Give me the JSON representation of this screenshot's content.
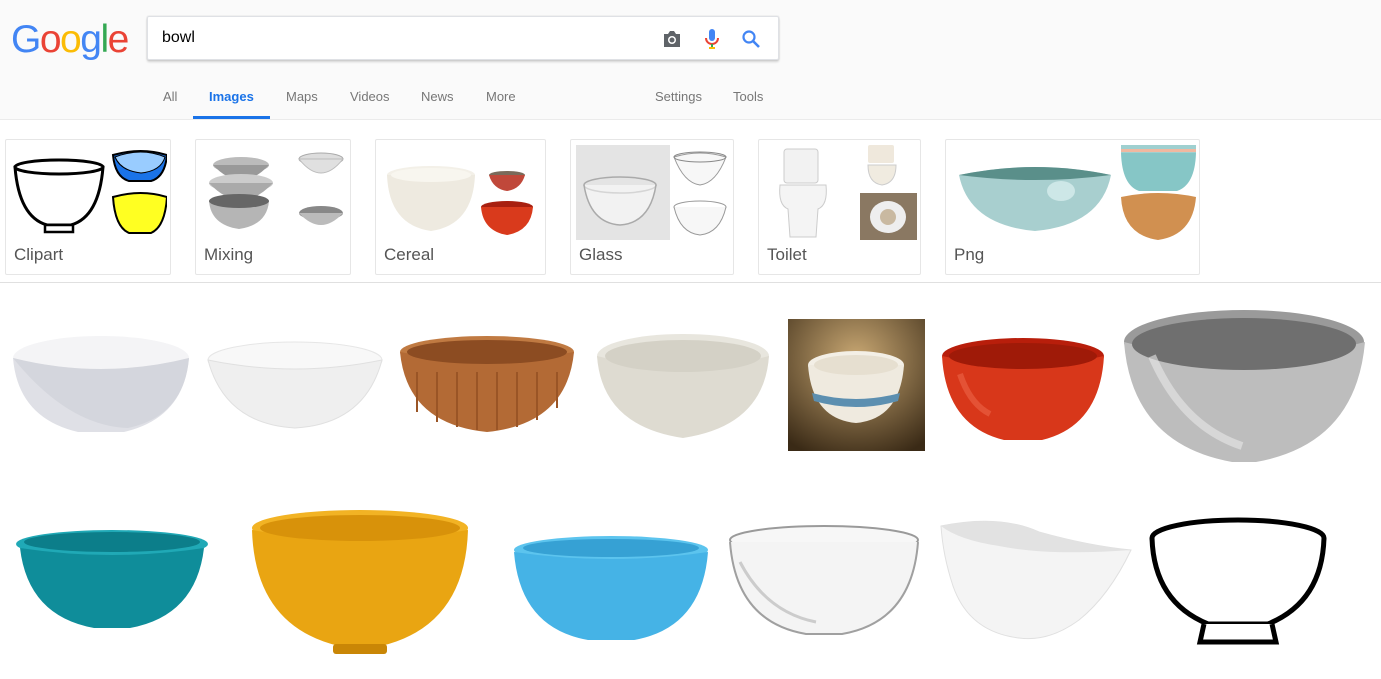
{
  "logo": {
    "letters": [
      "G",
      "o",
      "o",
      "g",
      "l",
      "e"
    ],
    "colors": [
      "#4285f4",
      "#ea4335",
      "#fbbc05",
      "#4285f4",
      "#34a853",
      "#ea4335"
    ]
  },
  "search": {
    "query": "bowl"
  },
  "icons": {
    "camera": "camera-icon",
    "mic": "microphone-icon",
    "search": "search-icon"
  },
  "tabs": [
    {
      "label": "All"
    },
    {
      "label": "Images",
      "active": true
    },
    {
      "label": "Maps"
    },
    {
      "label": "Videos"
    },
    {
      "label": "News"
    },
    {
      "label": "More"
    },
    {
      "label": "Settings"
    },
    {
      "label": "Tools"
    }
  ],
  "chips": [
    {
      "label": "Clipart"
    },
    {
      "label": "Mixing"
    },
    {
      "label": "Cereal"
    },
    {
      "label": "Glass"
    },
    {
      "label": "Toilet"
    },
    {
      "label": "Png"
    }
  ],
  "colors": {
    "accent": "#1a73e8",
    "tab_text": "#777777"
  }
}
